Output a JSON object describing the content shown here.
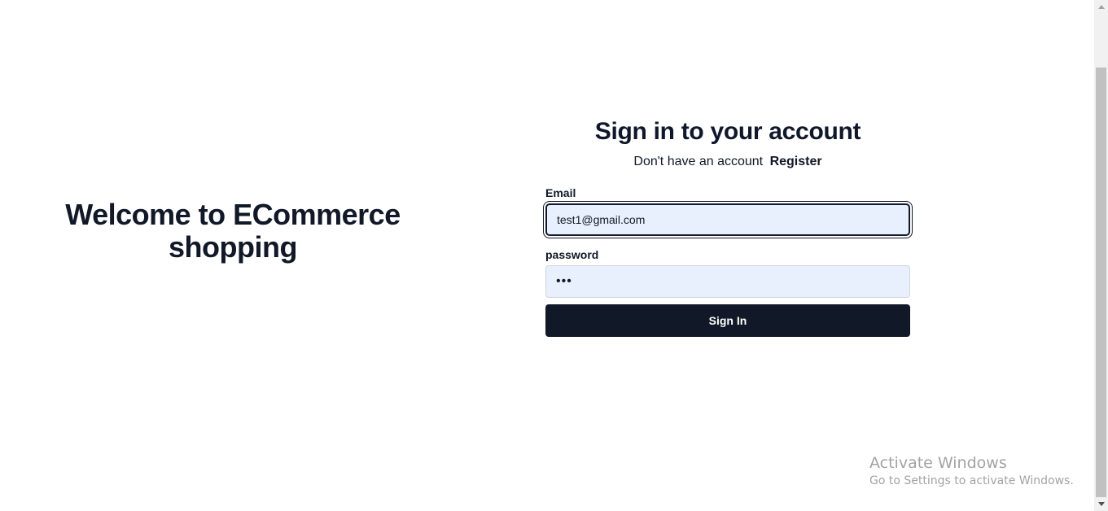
{
  "welcome": {
    "line1": "Welcome to ECommerce",
    "line2": "shopping"
  },
  "auth": {
    "title": "Sign in to your account",
    "subtitle": "Don't have an account",
    "register_link": "Register",
    "email_label": "Email",
    "email_value": "test1@gmail.com",
    "password_label": "password",
    "password_value": "•••",
    "submit_label": "Sign In"
  },
  "watermark": {
    "title": "Activate Windows",
    "subtitle": "Go to Settings to activate Windows."
  },
  "colors": {
    "primary": "#111827",
    "input_bg": "#e8f0fe"
  }
}
